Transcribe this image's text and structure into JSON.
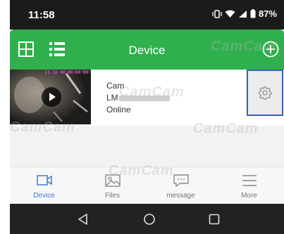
{
  "status_bar": {
    "time": "11:58",
    "battery": "87%"
  },
  "app_bar": {
    "title": "Device"
  },
  "device": {
    "name": "Cam",
    "id_prefix": "LM",
    "status": "Online",
    "thumb_timestamp": "11-18 00:00:00 00"
  },
  "tabs": [
    {
      "label": "Device",
      "active": true
    },
    {
      "label": "Files",
      "active": false
    },
    {
      "label": "message",
      "active": false
    },
    {
      "label": "More",
      "active": false
    }
  ],
  "watermark": "CamCam",
  "colors": {
    "accent_green": "#2fb04d",
    "tab_active": "#3b7bd6",
    "status_bar": "#1b1b1b",
    "nav_bar": "#222222"
  }
}
